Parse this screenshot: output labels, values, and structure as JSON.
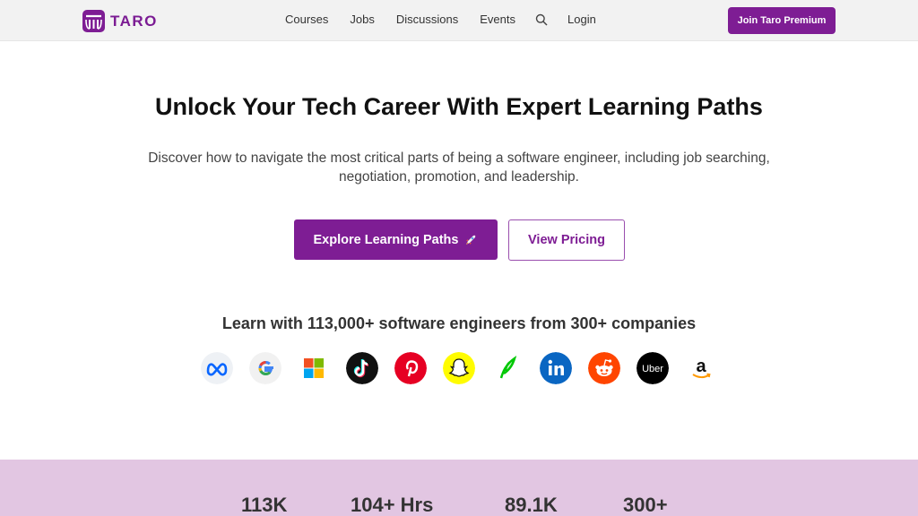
{
  "nav": {
    "logo_text": "TARO",
    "links": [
      "Courses",
      "Jobs",
      "Discussions",
      "Events"
    ],
    "login": "Login",
    "premium_button": "Join Taro Premium"
  },
  "hero": {
    "title": "Unlock Your Tech Career With Expert Learning Paths",
    "subtitle": "Discover how to navigate the most critical parts of being a software engineer, including job searching, negotiation, promotion, and leadership.",
    "primary_button": "Explore Learning Paths",
    "primary_button_icon": "rocket-icon",
    "secondary_button": "View Pricing"
  },
  "social_proof": {
    "heading": "Learn with 113,000+ software engineers from 300+ companies",
    "companies": [
      "meta",
      "google",
      "microsoft",
      "tiktok",
      "pinterest",
      "snapchat",
      "robinhood",
      "linkedin",
      "reddit",
      "uber",
      "amazon"
    ]
  },
  "stats": [
    "113K",
    "104+ Hrs",
    "89.1K",
    "300+"
  ],
  "colors": {
    "brand": "#7e1d94",
    "band": "#e2c6e2"
  }
}
